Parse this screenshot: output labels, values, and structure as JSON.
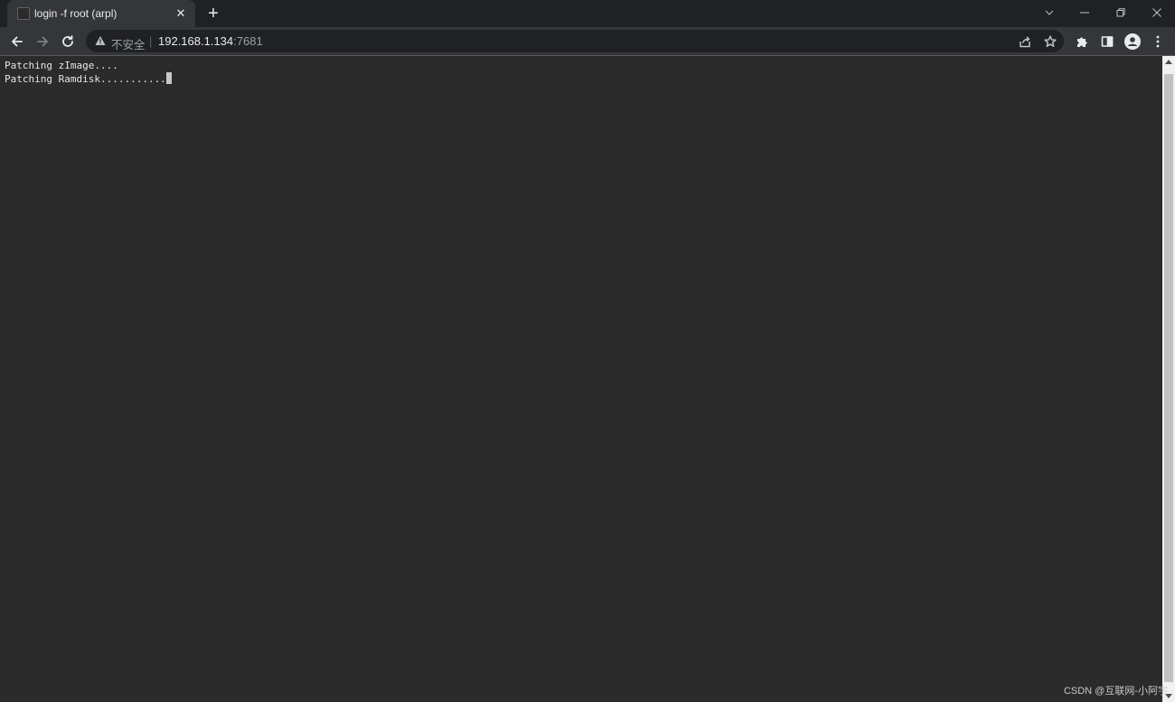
{
  "tab": {
    "title": "login -f root (arpl)",
    "close_glyph": "✕",
    "new_tab_glyph": "+"
  },
  "address_bar": {
    "security_label": "不安全",
    "separator": "|",
    "url_host": "192.168.1.134",
    "url_port": ":7681"
  },
  "terminal": {
    "lines": [
      "Patching zImage....",
      "Patching Ramdisk..........."
    ]
  },
  "watermark": "CSDN @互联网-小阿宇",
  "icons": {
    "back": "arrow-left-icon",
    "forward": "arrow-right-icon",
    "reload": "reload-icon",
    "warning": "warning-triangle-icon",
    "share": "share-icon",
    "bookmark": "star-icon",
    "extensions": "puzzle-icon",
    "side_panel": "side-panel-icon",
    "profile": "profile-icon",
    "menu": "kebab-menu-icon"
  }
}
